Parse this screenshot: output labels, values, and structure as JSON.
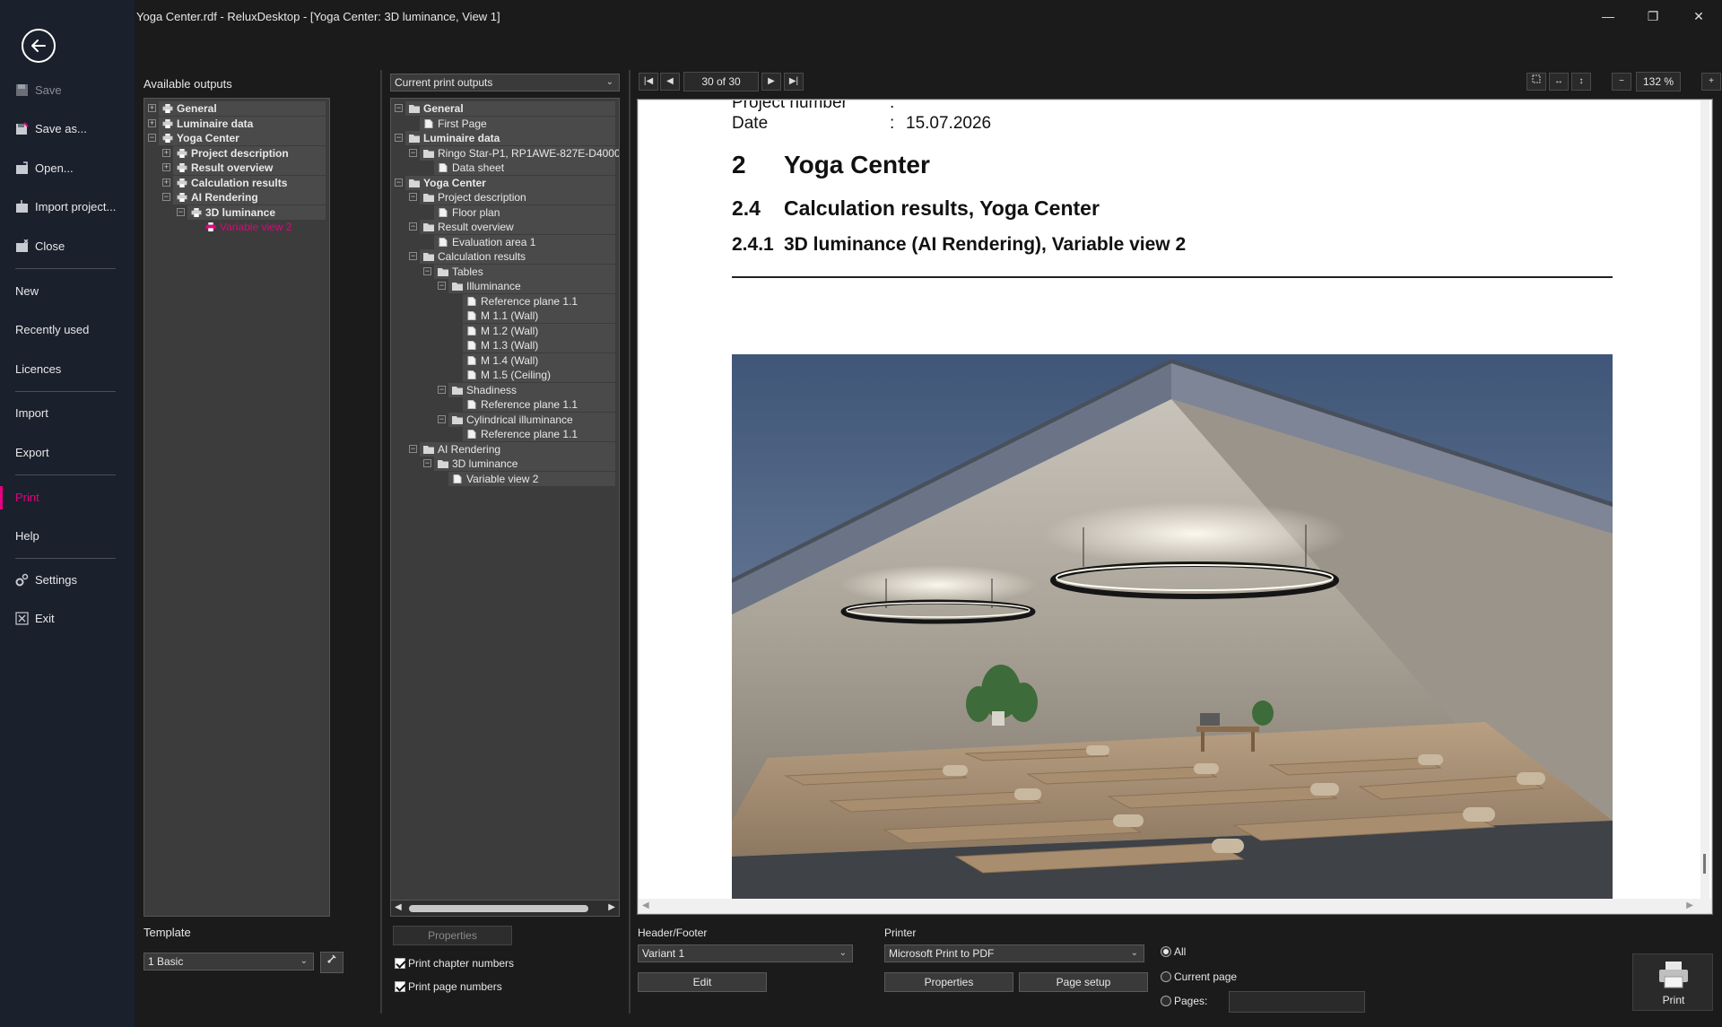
{
  "window": {
    "title": "Yoga Center.rdf - ReluxDesktop - [Yoga Center: 3D luminance, View 1]",
    "minimize": "—",
    "maximize": "❐",
    "close": "✕"
  },
  "sidebar": {
    "items": [
      {
        "label": "Save",
        "icon": "save-icon",
        "disabled": true
      },
      {
        "label": "Save as...",
        "icon": "save-as-icon"
      },
      {
        "label": "Open...",
        "icon": "open-icon"
      },
      {
        "label": "Import project...",
        "icon": "import-project-icon"
      },
      {
        "label": "Close",
        "icon": "close-project-icon"
      },
      {
        "label": "New"
      },
      {
        "label": "Recently used"
      },
      {
        "label": "Licences"
      },
      {
        "label": "Import"
      },
      {
        "label": "Export"
      },
      {
        "label": "Print",
        "active": true
      },
      {
        "label": "Help"
      },
      {
        "label": "Settings",
        "icon": "settings-icon"
      },
      {
        "label": "Exit",
        "icon": "exit-icon"
      }
    ],
    "accent": "#e6007e"
  },
  "available": {
    "label": "Available outputs",
    "tree": [
      {
        "label": "General",
        "level": 0,
        "expander": "+",
        "bold": true
      },
      {
        "label": "Luminaire data",
        "level": 0,
        "expander": "+",
        "bold": true
      },
      {
        "label": "Yoga Center",
        "level": 0,
        "expander": "−",
        "bold": true
      },
      {
        "label": "Project description",
        "level": 1,
        "expander": "+",
        "bold": true
      },
      {
        "label": "Result overview",
        "level": 1,
        "expander": "+",
        "bold": true
      },
      {
        "label": "Calculation results",
        "level": 1,
        "expander": "+",
        "bold": true
      },
      {
        "label": "AI Rendering",
        "level": 1,
        "expander": "−",
        "bold": true
      },
      {
        "label": "3D luminance",
        "level": 2,
        "expander": "−",
        "bold": true
      },
      {
        "label": "Variable view 2",
        "level": 3,
        "highlight": true
      }
    ]
  },
  "current": {
    "dropdown": "Current print outputs",
    "tree": [
      {
        "label": "General",
        "level": 0,
        "expander": "−",
        "bold": true,
        "folder": true
      },
      {
        "label": "First Page",
        "level": 1
      },
      {
        "label": "Luminaire data",
        "level": 0,
        "expander": "−",
        "bold": true,
        "folder": true
      },
      {
        "label": "Ringo Star-P1, RP1AWE-827E-D4000",
        "level": 1,
        "expander": "−",
        "folder": true
      },
      {
        "label": "Data sheet",
        "level": 2
      },
      {
        "label": "Yoga Center",
        "level": 0,
        "expander": "−",
        "bold": true,
        "folder": true
      },
      {
        "label": "Project description",
        "level": 1,
        "expander": "−",
        "folder": true
      },
      {
        "label": "Floor plan",
        "level": 2
      },
      {
        "label": "Result overview",
        "level": 1,
        "expander": "−",
        "folder": true
      },
      {
        "label": "Evaluation area 1",
        "level": 2
      },
      {
        "label": "Calculation results",
        "level": 1,
        "expander": "−",
        "folder": true
      },
      {
        "label": "Tables",
        "level": 2,
        "expander": "−",
        "folder": true
      },
      {
        "label": "Illuminance",
        "level": 3,
        "expander": "−",
        "folder": true
      },
      {
        "label": "Reference plane 1.1",
        "level": 4
      },
      {
        "label": "M 1.1 (Wall)",
        "level": 4
      },
      {
        "label": "M 1.2 (Wall)",
        "level": 4
      },
      {
        "label": "M 1.3 (Wall)",
        "level": 4
      },
      {
        "label": "M 1.4 (Wall)",
        "level": 4
      },
      {
        "label": "M 1.5 (Ceiling)",
        "level": 4
      },
      {
        "label": "Shadiness",
        "level": 3,
        "expander": "−",
        "folder": true
      },
      {
        "label": "Reference plane 1.1",
        "level": 4
      },
      {
        "label": "Cylindrical illuminance",
        "level": 3,
        "expander": "−",
        "folder": true
      },
      {
        "label": "Reference plane 1.1",
        "level": 4
      },
      {
        "label": "AI Rendering",
        "level": 1,
        "expander": "−",
        "folder": true
      },
      {
        "label": "3D luminance",
        "level": 2,
        "expander": "−",
        "folder": true
      },
      {
        "label": "Variable view 2",
        "level": 3
      }
    ],
    "properties_button": "Properties",
    "print_chapter_numbers": "Print chapter numbers",
    "print_page_numbers": "Print page numbers"
  },
  "template": {
    "label": "Template",
    "value": "1 Basic"
  },
  "preview": {
    "page_indicator": "30 of 30",
    "zoom": "132 %",
    "zoom_out": "−",
    "zoom_in": "+",
    "doc": {
      "project_number_label": "Project number",
      "project_number_colon": ":",
      "date_label": "Date",
      "date_colon": ":",
      "date_value": "15.07.2026",
      "h1_num": "2",
      "h1_text": "Yoga Center",
      "h2_num": "2.4",
      "h2_text": "Calculation results, Yoga Center",
      "h3_num": "2.4.1",
      "h3_text": "3D luminance (AI Rendering), Variable view 2"
    }
  },
  "header_footer": {
    "label": "Header/Footer",
    "value": "Variant 1",
    "edit_button": "Edit"
  },
  "printer": {
    "label": "Printer",
    "value": "Microsoft Print to PDF",
    "properties_button": "Properties",
    "page_setup_button": "Page setup",
    "range_all": "All",
    "range_current": "Current page",
    "range_pages": "Pages:",
    "pages_value": ""
  },
  "print_button": "Print"
}
